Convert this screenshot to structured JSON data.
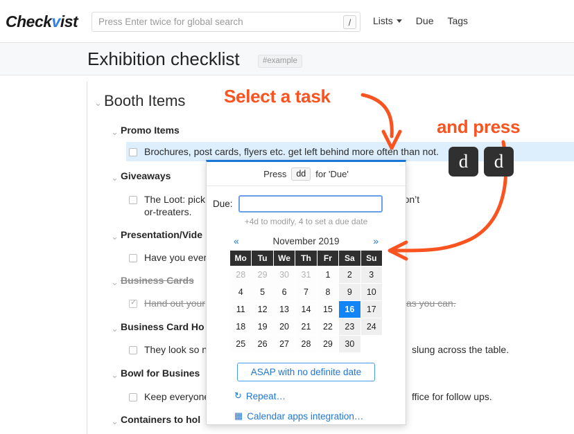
{
  "header": {
    "logo_prefix": "Check",
    "logo_accent": "v",
    "logo_suffix": "ist",
    "accent_color": "#2f7fe8"
  },
  "search": {
    "placeholder": "Press Enter twice for global search",
    "value": "",
    "shortcut_key": "/"
  },
  "nav": {
    "lists": "Lists",
    "due": "Due",
    "tags": "Tags"
  },
  "page": {
    "title": "Exhibition checklist",
    "tag": "#example"
  },
  "outline": [
    {
      "level": "h1",
      "text": "Booth Items"
    },
    {
      "level": "h2",
      "text": "Promo Items"
    },
    {
      "level": "item",
      "text": "Brochures, post cards, flyers etc. get left behind more often than not."
    },
    {
      "level": "h2",
      "text": "Giveaways"
    },
    {
      "level": "item",
      "text": "The Loot: pick"
    },
    {
      "level": "item_cont",
      "text": "or-treaters."
    },
    {
      "level": "item_tail",
      "text": "t don’t"
    },
    {
      "level": "h2",
      "text": "Presentation/Vide"
    },
    {
      "level": "item",
      "text": "Have you ever"
    },
    {
      "level": "h2done",
      "text": "Business Cards"
    },
    {
      "level": "itemdone",
      "text": "Hand out your"
    },
    {
      "level": "itemdone_tail",
      "text": "as you can."
    },
    {
      "level": "h2",
      "text": "Business Card Ho"
    },
    {
      "level": "item",
      "text": "They look so n"
    },
    {
      "level": "item_tail",
      "text": "slung across the table."
    },
    {
      "level": "h2",
      "text": "Bowl for Busines"
    },
    {
      "level": "item",
      "text": "Keep everyone"
    },
    {
      "level": "item_tail",
      "text": "ffice for follow ups."
    },
    {
      "level": "h2",
      "text": "Containers to hol"
    }
  ],
  "popup": {
    "hint_press": "Press",
    "hint_key": "dd",
    "hint_for": "for 'Due'",
    "due_label": "Due:",
    "due_value": "",
    "due_hint": "+4d to modify, 4 to set a due date",
    "asap_label": "ASAP with no definite date",
    "repeat_label": "Repeat…",
    "calendar_label": "Calendar apps integration…",
    "repeat_icon": "↻",
    "calendar_icon": "▦"
  },
  "calendar": {
    "prev": "«",
    "next": "»",
    "month_label": "November 2019",
    "weekdays": [
      "Mo",
      "Tu",
      "We",
      "Th",
      "Fr",
      "Sa",
      "Su"
    ],
    "selected_day": 16,
    "cells": [
      {
        "d": "28",
        "mute": true
      },
      {
        "d": "29",
        "mute": true
      },
      {
        "d": "30",
        "mute": true
      },
      {
        "d": "31",
        "mute": true
      },
      {
        "d": "1"
      },
      {
        "d": "2",
        "we": true
      },
      {
        "d": "3",
        "we": true
      },
      {
        "d": "4"
      },
      {
        "d": "5"
      },
      {
        "d": "6"
      },
      {
        "d": "7"
      },
      {
        "d": "8"
      },
      {
        "d": "9",
        "we": true
      },
      {
        "d": "10",
        "we": true
      },
      {
        "d": "11"
      },
      {
        "d": "12"
      },
      {
        "d": "13"
      },
      {
        "d": "14"
      },
      {
        "d": "15"
      },
      {
        "d": "16",
        "we": true,
        "sel": true
      },
      {
        "d": "17",
        "we": true
      },
      {
        "d": "18"
      },
      {
        "d": "19"
      },
      {
        "d": "20"
      },
      {
        "d": "21"
      },
      {
        "d": "22"
      },
      {
        "d": "23",
        "we": true
      },
      {
        "d": "24",
        "we": true
      },
      {
        "d": "25"
      },
      {
        "d": "26"
      },
      {
        "d": "27"
      },
      {
        "d": "28"
      },
      {
        "d": "29"
      },
      {
        "d": "30",
        "we": true
      },
      {
        "d": "",
        "blank": true
      }
    ]
  },
  "annotations": {
    "select_task": "Select a task",
    "and_press": "and press",
    "key_1": "d",
    "key_2": "d",
    "color": "#f9531f"
  }
}
